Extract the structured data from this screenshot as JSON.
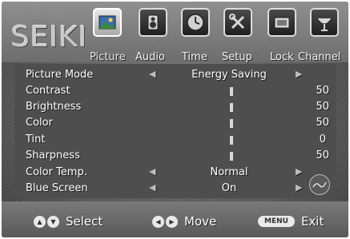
{
  "logo": "SEIKI",
  "tabs": [
    {
      "label": "Picture",
      "icon": "picture-icon",
      "active": true
    },
    {
      "label": "Audio",
      "icon": "audio-icon",
      "active": false
    },
    {
      "label": "Time",
      "icon": "clock-icon",
      "active": false
    },
    {
      "label": "Setup",
      "icon": "wrench-icon",
      "active": false
    },
    {
      "label": "Lock",
      "icon": "lock-icon",
      "active": false
    },
    {
      "label": "Channel",
      "icon": "satellite-dish-icon",
      "active": false
    }
  ],
  "menu": {
    "picture_mode": {
      "label": "Picture Mode",
      "value": "Energy Saving"
    },
    "contrast": {
      "label": "Contrast",
      "value": "50"
    },
    "brightness": {
      "label": "Brightness",
      "value": "50"
    },
    "color": {
      "label": "Color",
      "value": "50"
    },
    "tint": {
      "label": "Tint",
      "value": "0"
    },
    "sharpness": {
      "label": "Sharpness",
      "value": "50"
    },
    "color_temp": {
      "label": "Color Temp.",
      "value": "Normal"
    },
    "blue_screen": {
      "label": "Blue Screen",
      "value": "On"
    }
  },
  "footer": {
    "select_label": "Select",
    "move_label": "Move",
    "menu_key": "MENU",
    "exit_label": "Exit"
  }
}
